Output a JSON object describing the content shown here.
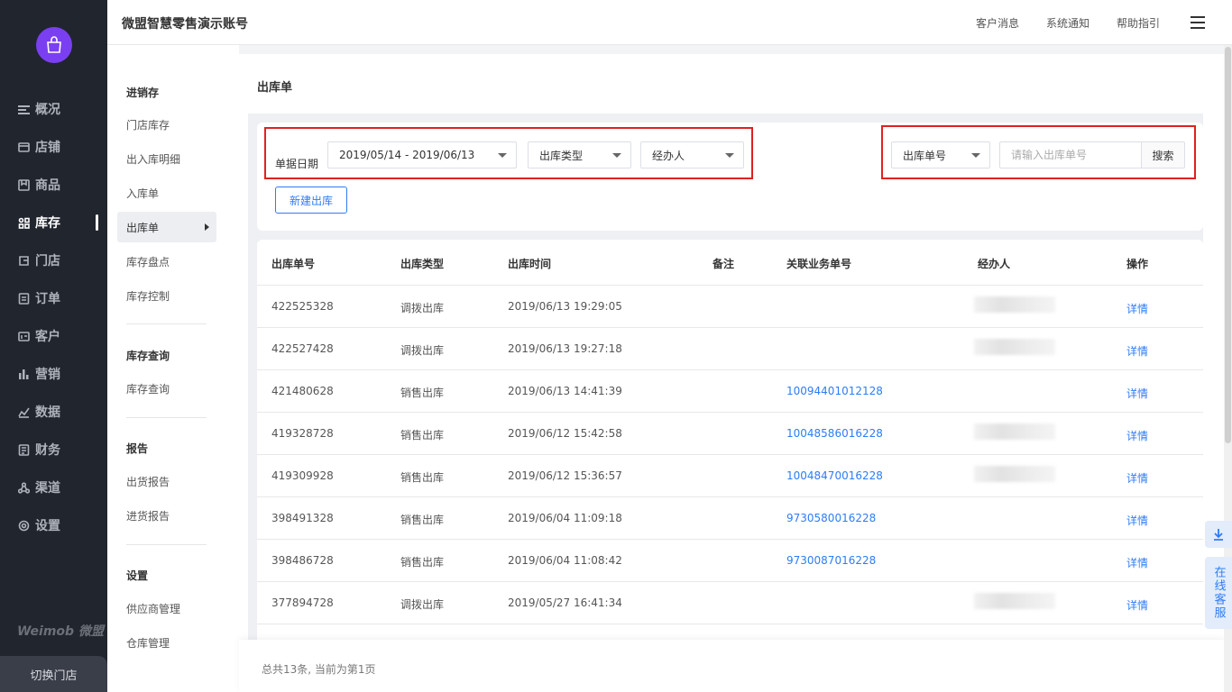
{
  "account_title": "微盟智慧零售演示账号",
  "top_links": [
    "客户消息",
    "系统通知",
    "帮助指引"
  ],
  "nav": [
    {
      "label": "概况",
      "icon": "overview-icon"
    },
    {
      "label": "店铺",
      "icon": "shop-icon"
    },
    {
      "label": "商品",
      "icon": "goods-icon"
    },
    {
      "label": "库存",
      "icon": "inventory-icon",
      "active": true
    },
    {
      "label": "门店",
      "icon": "store-icon"
    },
    {
      "label": "订单",
      "icon": "order-icon"
    },
    {
      "label": "客户",
      "icon": "customer-icon"
    },
    {
      "label": "营销",
      "icon": "marketing-icon"
    },
    {
      "label": "数据",
      "icon": "data-icon"
    },
    {
      "label": "财务",
      "icon": "finance-icon"
    },
    {
      "label": "渠道",
      "icon": "channel-icon"
    },
    {
      "label": "设置",
      "icon": "settings-icon"
    }
  ],
  "brand": "Weimob 微盟",
  "switch_store": "切换门店",
  "subnav": {
    "group1": {
      "title": "进销存",
      "items": [
        "门店库存",
        "出入库明细",
        "入库单",
        "出库单",
        "库存盘点",
        "库存控制"
      ]
    },
    "group2": {
      "title": "库存查询",
      "items": [
        "库存查询"
      ]
    },
    "group3": {
      "title": "报告",
      "items": [
        "出货报告",
        "进货报告"
      ]
    },
    "group4": {
      "title": "设置",
      "items": [
        "供应商管理",
        "仓库管理"
      ]
    }
  },
  "page_title": "出库单",
  "filters": {
    "date_label": "单据日期",
    "date_value": "2019/05/14 - 2019/06/13",
    "type_select": "出库类型",
    "handler_select": "经办人",
    "search_type": "出库单号",
    "search_placeholder": "请输入出库单号",
    "search_button": "搜索",
    "new_button": "新建出库"
  },
  "table": {
    "headers": [
      "出库单号",
      "出库类型",
      "出库时间",
      "备注",
      "关联业务单号",
      "经办人",
      "操作"
    ],
    "rows": [
      {
        "no": "422525328",
        "type": "调拨出库",
        "time": "2019/06/13 19:29:05",
        "remark": "",
        "related": "",
        "action": "详情"
      },
      {
        "no": "422527428",
        "type": "调拨出库",
        "time": "2019/06/13 19:27:18",
        "remark": "",
        "related": "",
        "action": "详情"
      },
      {
        "no": "421480628",
        "type": "销售出库",
        "time": "2019/06/13 14:41:39",
        "remark": "",
        "related": "10094401012128",
        "action": "详情"
      },
      {
        "no": "419328728",
        "type": "销售出库",
        "time": "2019/06/12 15:42:58",
        "remark": "",
        "related": "10048586016228",
        "action": "详情"
      },
      {
        "no": "419309928",
        "type": "销售出库",
        "time": "2019/06/12 15:36:57",
        "remark": "",
        "related": "10048470016228",
        "action": "详情"
      },
      {
        "no": "398491328",
        "type": "销售出库",
        "time": "2019/06/04 11:09:18",
        "remark": "",
        "related": "9730580016228",
        "action": "详情"
      },
      {
        "no": "398486728",
        "type": "销售出库",
        "time": "2019/06/04 11:08:42",
        "remark": "",
        "related": "9730087016228",
        "action": "详情"
      },
      {
        "no": "377894728",
        "type": "调拨出库",
        "time": "2019/05/27 16:41:34",
        "remark": "",
        "related": "",
        "action": "详情"
      }
    ]
  },
  "footer_text": "总共13条, 当前为第1页",
  "online_service": "在线客服",
  "colors": {
    "accent": "#2d7cf6",
    "nav_bg": "#21252e",
    "logo": "#7b3ff2",
    "highlight": "#e02020"
  }
}
